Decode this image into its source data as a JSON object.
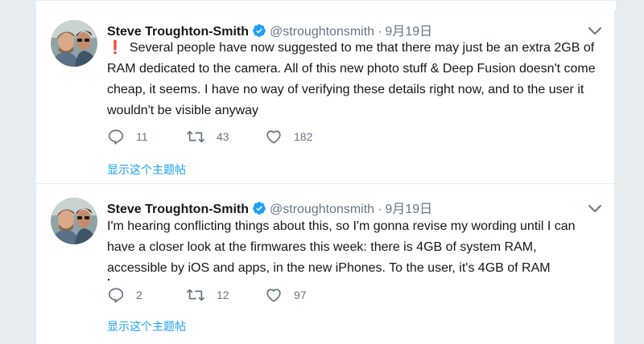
{
  "colors": {
    "accent": "#1da1f2",
    "muted": "#657786",
    "alert": "#e0245e",
    "background": "#e6ecf0"
  },
  "tweets": [
    {
      "author_name": "Steve Troughton-Smith",
      "handle": "@stroughtonsmith",
      "separator": "·",
      "date": "9月19日",
      "prefix_icon": "exclamation-icon",
      "prefix": "❗",
      "text": "Several people have now suggested to me that there may just be an extra 2GB of RAM dedicated to the camera. All of this new photo stuff & Deep Fusion doesn't come cheap, it seems. I have no way of verifying these details right now, and to the user it wouldn't be visible anyway",
      "replies": "11",
      "retweets": "43",
      "likes": "182",
      "thread_link": "显示这个主题帖"
    },
    {
      "author_name": "Steve Troughton-Smith",
      "handle": "@stroughtonsmith",
      "separator": "·",
      "date": "9月19日",
      "text": "I'm hearing conflicting things about this, so I'm gonna revise my wording until I can have a closer look at the firmwares this week: there is 4GB of system RAM, accessible by iOS and apps, in the new iPhones. To the user, it's 4GB of RAM",
      "replies": "2",
      "retweets": "12",
      "likes": "97",
      "thread_link": "显示这个主题帖"
    }
  ]
}
